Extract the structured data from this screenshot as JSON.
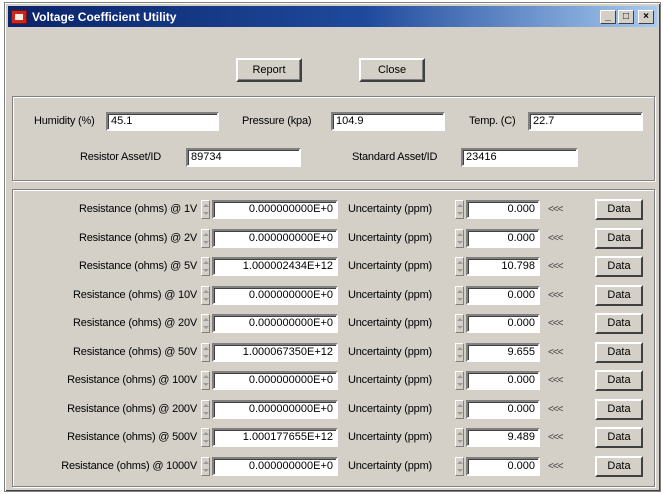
{
  "window": {
    "title": "Voltage Coefficient Utility",
    "controls": {
      "minimize": "_",
      "maximize": "□",
      "close": "×"
    }
  },
  "toolbar": {
    "report_label": "Report",
    "close_label": "Close"
  },
  "conditions": {
    "humidity_label": "Humidity (%)",
    "humidity_value": "45.1",
    "pressure_label": "Pressure (kpa)",
    "pressure_value": "104.9",
    "temp_label": "Temp. (C)",
    "temp_value": "22.7",
    "resistor_label": "Resistor Asset/ID",
    "resistor_value": "89734",
    "standard_label": "Standard Asset/ID",
    "standard_value": "23416"
  },
  "measurements": [
    {
      "res_label": "Resistance (ohms) @ 1V",
      "res_value": "0.000000000E+0",
      "unc_label": "Uncertainty (ppm)",
      "unc_value": "0.000",
      "arrows": "<<<",
      "data_label": "Data"
    },
    {
      "res_label": "Resistance (ohms) @ 2V",
      "res_value": "0.000000000E+0",
      "unc_label": "Uncertainty (ppm)",
      "unc_value": "0.000",
      "arrows": "<<<",
      "data_label": "Data"
    },
    {
      "res_label": "Resistance (ohms) @ 5V",
      "res_value": "1.000002434E+12",
      "unc_label": "Uncertainty (ppm)",
      "unc_value": "10.798",
      "arrows": "<<<",
      "data_label": "Data"
    },
    {
      "res_label": "Resistance (ohms) @ 10V",
      "res_value": "0.000000000E+0",
      "unc_label": "Uncertainty (ppm)",
      "unc_value": "0.000",
      "arrows": "<<<",
      "data_label": "Data"
    },
    {
      "res_label": "Resistance (ohms) @ 20V",
      "res_value": "0.000000000E+0",
      "unc_label": "Uncertainty (ppm)",
      "unc_value": "0.000",
      "arrows": "<<<",
      "data_label": "Data"
    },
    {
      "res_label": "Resistance (ohms) @ 50V",
      "res_value": "1.000067350E+12",
      "unc_label": "Uncertainty (ppm)",
      "unc_value": "9.655",
      "arrows": "<<<",
      "data_label": "Data"
    },
    {
      "res_label": "Resistance (ohms) @ 100V",
      "res_value": "0.000000000E+0",
      "unc_label": "Uncertainty (ppm)",
      "unc_value": "0.000",
      "arrows": "<<<",
      "data_label": "Data"
    },
    {
      "res_label": "Resistance (ohms) @ 200V",
      "res_value": "0.000000000E+0",
      "unc_label": "Uncertainty (ppm)",
      "unc_value": "0.000",
      "arrows": "<<<",
      "data_label": "Data"
    },
    {
      "res_label": "Resistance (ohms) @ 500V",
      "res_value": "1.000177655E+12",
      "unc_label": "Uncertainty (ppm)",
      "unc_value": "9.489",
      "arrows": "<<<",
      "data_label": "Data"
    },
    {
      "res_label": "Resistance (ohms) @ 1000V",
      "res_value": "0.000000000E+0",
      "unc_label": "Uncertainty (ppm)",
      "unc_value": "0.000",
      "arrows": "<<<",
      "data_label": "Data"
    }
  ]
}
